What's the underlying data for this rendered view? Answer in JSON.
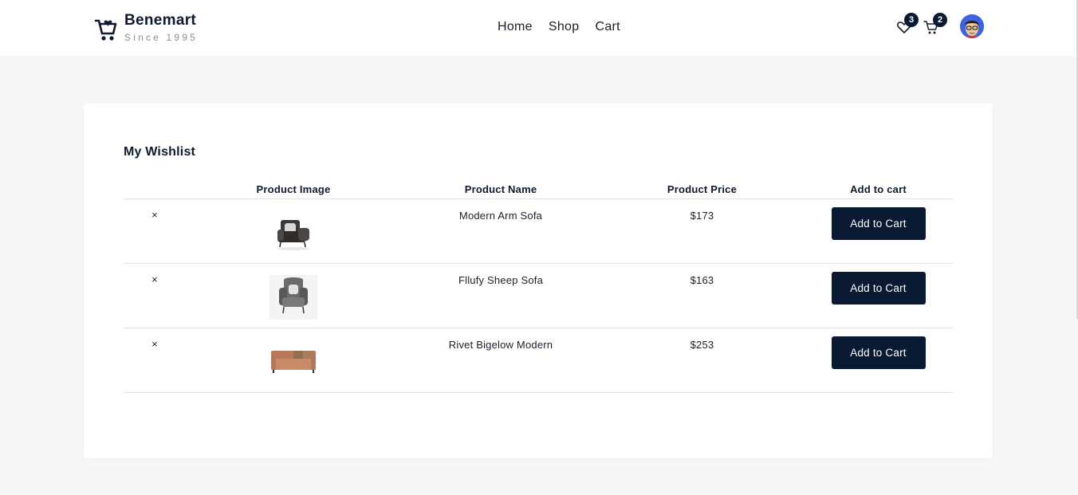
{
  "header": {
    "brand_name": "Benemart",
    "brand_tagline": "Since 1995",
    "nav": [
      {
        "label": "Home"
      },
      {
        "label": "Shop"
      },
      {
        "label": "Cart"
      }
    ],
    "wishlist_count": "3",
    "cart_count": "2",
    "icons": [
      "shopping-cart-logo-icon",
      "heart-icon",
      "cart-icon",
      "user-avatar"
    ]
  },
  "wishlist": {
    "title": "My Wishlist",
    "columns": [
      "",
      "Product Image",
      "Product Name",
      "Product Price",
      "Add to cart"
    ],
    "remove_symbol": "×",
    "rows": [
      {
        "name": "Modern Arm Sofa",
        "price": "$173",
        "button": "Add to Cart",
        "image": "dark-armchair"
      },
      {
        "name": "Fllufy Sheep Sofa",
        "price": "$163",
        "button": "Add to Cart",
        "image": "grey-wingback-chair"
      },
      {
        "name": "Rivet Bigelow Modern",
        "price": "$253",
        "button": "Add to Cart",
        "image": "tan-leather-sofa"
      }
    ]
  },
  "colors": {
    "primary": "#0b1a33",
    "background": "#f6f6f6",
    "card": "#ffffff",
    "text": "#0f1a2e"
  }
}
